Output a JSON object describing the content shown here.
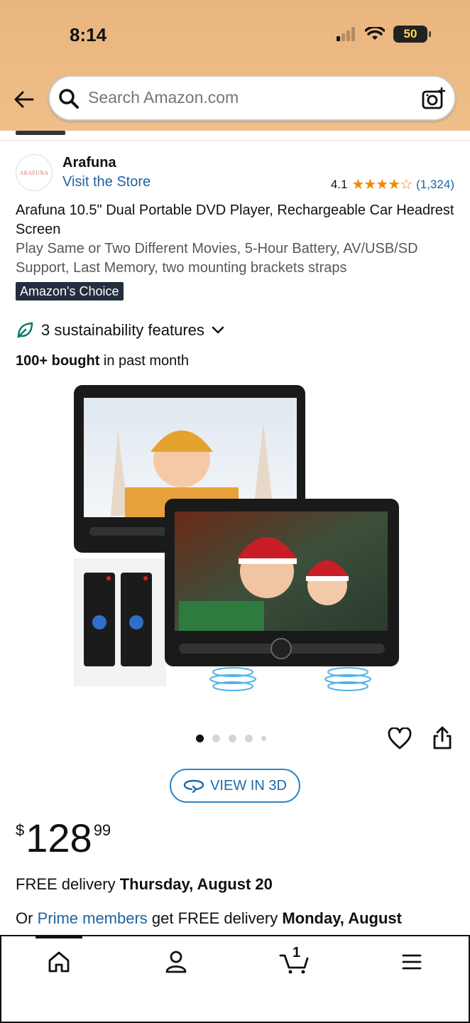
{
  "status_bar": {
    "time": "8:14",
    "battery": "50"
  },
  "search": {
    "placeholder": "Search Amazon.com"
  },
  "store": {
    "logo_text": "ARAFUNA",
    "brand": "Arafuna",
    "visit_label": "Visit the Store"
  },
  "rating": {
    "value": "4.1",
    "stars": "★★★★☆",
    "count": "(1,324)"
  },
  "product": {
    "title": "Arafuna 10.5\" Dual Portable DVD Player, Rechargeable Car Headrest Screen",
    "subtitle": "Play Same or Two Different Movies, 5-Hour Battery, AV/USB/SD Support, Last Memory, two mounting brackets straps",
    "badge": "Amazon's Choice"
  },
  "sustainability": {
    "label": "3 sustainability features"
  },
  "bought": {
    "bold": "100+ bought",
    "rest": " in past month"
  },
  "image_carousel": {
    "total": 5,
    "active_index": 0
  },
  "view3d": {
    "label": "VIEW IN 3D"
  },
  "price": {
    "symbol": "$",
    "whole": "128",
    "fraction": "99"
  },
  "delivery": {
    "prefix": "FREE delivery ",
    "date": "Thursday, August 20",
    "prime_prefix": "Or ",
    "prime_link": "Prime members",
    "prime_middle": " get FREE delivery ",
    "prime_date": "Monday, August"
  },
  "cart": {
    "count": "1"
  },
  "colors": {
    "header": "#f0bf89",
    "link": "#2162a1",
    "star": "#f08804",
    "badge": "#232f3e",
    "view3d_border": "#2f86c9"
  }
}
